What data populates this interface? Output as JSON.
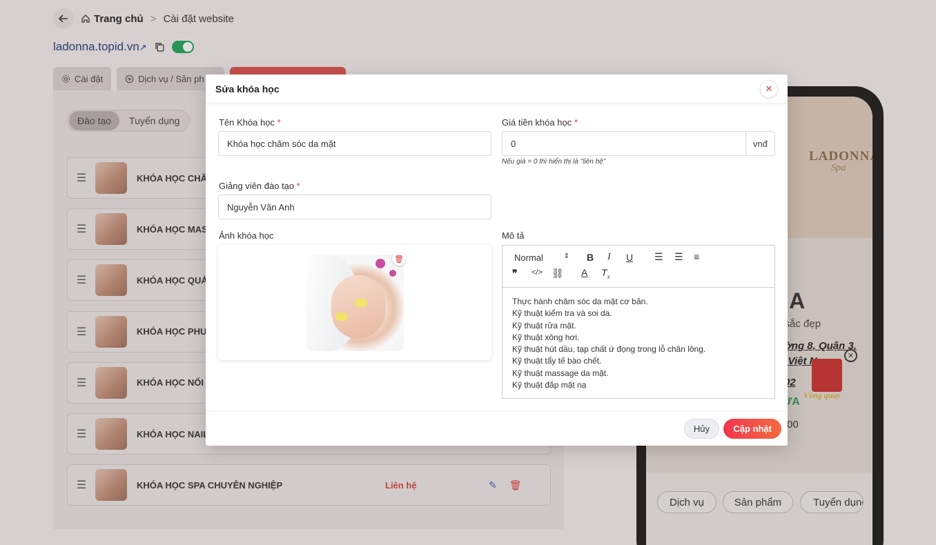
{
  "breadcrumb": {
    "home": "Trang chủ",
    "separator": ">",
    "current": "Cài đặt website"
  },
  "site": {
    "domain": "ladonna.topid.vn",
    "link_arrow": "↗",
    "published": true
  },
  "tabs": [
    {
      "label": "Cài đặt"
    },
    {
      "label": "Dịch vụ / Sản ph"
    },
    {
      "label": ""
    }
  ],
  "segment": {
    "options": [
      "Đào tạo",
      "Tuyển dụng"
    ],
    "selected": "Đào tạo"
  },
  "courses": [
    {
      "name": "KHÓA HỌC CHĂM"
    },
    {
      "name": "KHÓA HỌC MASS"
    },
    {
      "name": "KHÓA HỌC QUẢN"
    },
    {
      "name": "KHÓA HỌC PHUN"
    },
    {
      "name": "KHÓA HỌC NỐI M"
    },
    {
      "name": "KHÓA HỌC NAIL"
    },
    {
      "name": "KHÓA HỌC SPA CHUYÊN NGHIỆP",
      "price": "Liên hệ"
    }
  ],
  "phone_preview": {
    "brand": "LADONNA",
    "brand_script": "Spa",
    "title": "NA",
    "subtitle": "a sắc đẹp",
    "address_1": "ường 8, Quận 3,",
    "address_2": "h, Việt N",
    "phone": "02",
    "status": "ỬA",
    "hours": "00",
    "gift_label": "Vòng quay",
    "nav": [
      "Dịch vụ",
      "Sản phẩm",
      "Tuyển dụng"
    ]
  },
  "modal": {
    "title": "Sửa khóa học",
    "fields": {
      "course_name": {
        "label": "Tên Khóa học",
        "value": "Khóa học chăm sóc da mặt"
      },
      "price": {
        "label": "Giá tiền khóa học",
        "value": "0",
        "unit": "vnđ",
        "hint": "Nếu giá = 0 thì hiển thị là \"liên hệ\""
      },
      "instructor": {
        "label": "Giảng viên đào tạo",
        "value": "Nguyễn Vân Anh"
      },
      "image": {
        "label": "Ảnh khóa học"
      },
      "description": {
        "label": "Mô tả",
        "format": "Normal",
        "lines": [
          "Thực hành chăm sóc da mặt cơ bản.",
          "Kỹ thuật kiểm tra và soi da.",
          "Kỹ thuật rửa mặt.",
          "Kỹ thuật xông hơi.",
          "Kỹ thuật hút dầu, tạp chất ứ đọng trong lỗ chân lông.",
          "Kỹ thuật tẩy tế bào chết.",
          "Kỹ thuật massage da mặt.",
          "Kỹ thuật đắp mặt nạ"
        ]
      }
    },
    "required_mark": "*",
    "buttons": {
      "cancel": "Hủy",
      "save": "Cập nhật"
    }
  },
  "colors": {
    "accent": "#f0364f",
    "required": "#e03b3b",
    "toggle_on": "#20a45a",
    "link": "#1f3b7a"
  }
}
